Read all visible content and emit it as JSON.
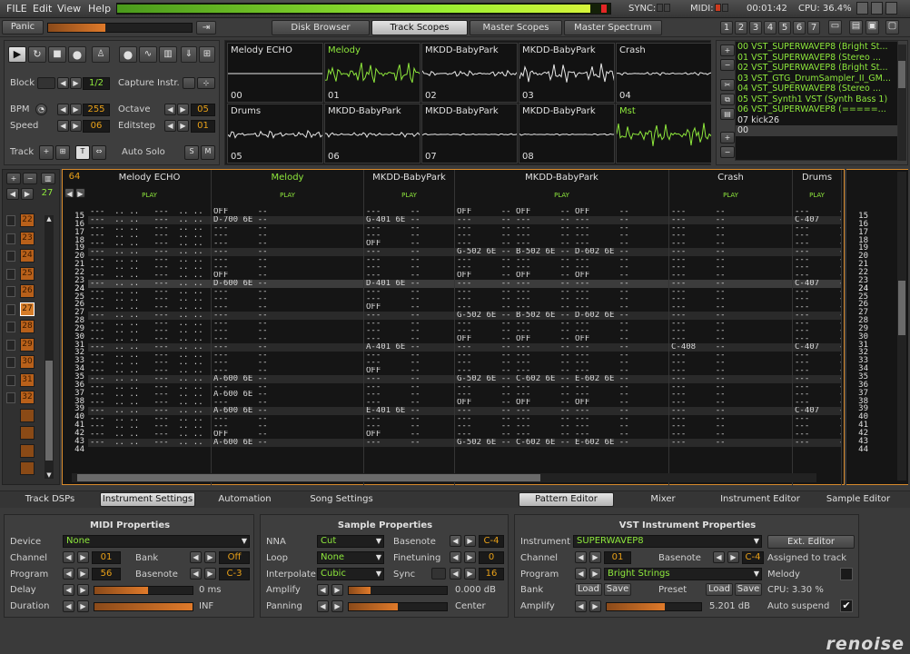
{
  "menu": {
    "file": "FILE",
    "edit": "Edit",
    "view": "View",
    "help": "Help"
  },
  "status": {
    "sync": "SYNC:",
    "midi": "MIDI:",
    "time": "00:01:42",
    "cpu": "CPU: 36.4%"
  },
  "toolbar": {
    "panic": "Panic",
    "tabs": [
      "Disk Browser",
      "Track Scopes",
      "Master Scopes",
      "Master Spectrum"
    ],
    "active_tab": "Track Scopes",
    "pages": [
      "1",
      "2",
      "3",
      "4",
      "5",
      "6",
      "7"
    ]
  },
  "transport": {
    "block_label": "Block",
    "block_value": "1/2",
    "capture_label": "Capture Instr.",
    "bpm_label": "BPM",
    "bpm_value": "255",
    "octave_label": "Octave",
    "octave_value": "05",
    "speed_label": "Speed",
    "speed_value": "06",
    "editstep_label": "Editstep",
    "editstep_value": "01",
    "track_label": "Track",
    "autosolo_label": "Auto Solo"
  },
  "scopes": [
    {
      "name": "Melody ECHO",
      "num": "00"
    },
    {
      "name": "Melody",
      "num": "01"
    },
    {
      "name": "MKDD-BabyPark",
      "num": "02"
    },
    {
      "name": "MKDD-BabyPark",
      "num": "03"
    },
    {
      "name": "Crash",
      "num": "04"
    },
    {
      "name": "Drums",
      "num": "05"
    },
    {
      "name": "MKDD-BabyPark",
      "num": "06"
    },
    {
      "name": "MKDD-BabyPark",
      "num": "07"
    },
    {
      "name": "MKDD-BabyPark",
      "num": "08"
    },
    {
      "name": "Mst",
      "num": ""
    }
  ],
  "instruments": [
    "00 VST_SUPERWAVEP8 (Bright St...",
    "01 VST_SUPERWAVEP8 (Stereo ...",
    "02 VST_SUPERWAVEP8 (Bright St...",
    "03 VST_GTG_DrumSampler_II_GM...",
    "04 VST_SUPERWAVEP8 (Stereo ...",
    "05 VST_Synth1 VST (Synth Bass 1)",
    "06 VST_SUPERWAVEP8 (=====...",
    "07 kick26",
    "00"
  ],
  "pattern": {
    "lines": "64",
    "seq_pos": "27",
    "tracks": [
      "Melody ECHO",
      "Melody",
      "MKDD-BabyPark",
      "MKDD-BabyPark",
      "Crash",
      "Drums"
    ],
    "play": "PLAY",
    "row_numbers": [
      "15",
      "16",
      "17",
      "18",
      "19",
      "20",
      "21",
      "22",
      "23",
      "24",
      "25",
      "26",
      "27",
      "28",
      "29",
      "30",
      "31",
      "32",
      "33",
      "34",
      "35",
      "36",
      "37",
      "38",
      "39",
      "40",
      "41",
      "42",
      "43",
      "44"
    ],
    "sequence": [
      "22",
      "23",
      "24",
      "25",
      "26",
      "27",
      "28",
      "29",
      "30",
      "31",
      "32"
    ],
    "melody": [
      "OFF",
      "D-700 6E",
      "---",
      "---",
      "---",
      "---",
      "---",
      "---",
      "OFF",
      "D-600 6E",
      "---",
      "---",
      "---",
      "---",
      "---",
      "---",
      "---",
      "---",
      "---",
      "---",
      "---",
      "A-600 6E",
      "---",
      "A-600 6E",
      "---",
      "A-600 6E",
      "---",
      "---",
      "OFF",
      "A-600 6E"
    ],
    "mkdd1": [
      "---",
      "G-401 6E",
      "---",
      "---",
      "OFF",
      "---",
      "---",
      "---",
      "---",
      "D-401 6E",
      "---",
      "---",
      "OFF",
      "---",
      "---",
      "---",
      "---",
      "A-401 6E",
      "---",
      "---",
      "OFF",
      "---",
      "---",
      "---",
      "---",
      "E-401 6E",
      "---",
      "---",
      "OFF",
      "---"
    ],
    "mkdd2a": [
      "OFF",
      "---",
      "---",
      "---",
      "---",
      "G-502 6E",
      "---",
      "---",
      "OFF",
      "---",
      "---",
      "---",
      "---",
      "G-502 6E",
      "---",
      "---",
      "OFF",
      "---",
      "---",
      "---",
      "---",
      "G-502 6E",
      "---",
      "---",
      "OFF",
      "---",
      "---",
      "---",
      "---",
      "G-502 6E"
    ],
    "mkdd2b": [
      "OFF",
      "---",
      "---",
      "---",
      "---",
      "B-502 6E",
      "---",
      "---",
      "OFF",
      "---",
      "---",
      "---",
      "---",
      "B-502 6E",
      "---",
      "---",
      "OFF",
      "---",
      "---",
      "---",
      "---",
      "C-602 6E",
      "---",
      "---",
      "OFF",
      "---",
      "---",
      "---",
      "---",
      "C-602 6E"
    ],
    "mkdd2c": [
      "OFF",
      "---",
      "---",
      "---",
      "---",
      "D-602 6E",
      "---",
      "---",
      "OFF",
      "---",
      "---",
      "---",
      "---",
      "D-602 6E",
      "---",
      "---",
      "OFF",
      "---",
      "---",
      "---",
      "---",
      "E-602 6E",
      "---",
      "---",
      "OFF",
      "---",
      "---",
      "---",
      "---",
      "E-602 6E"
    ],
    "crash": [
      "---",
      "---",
      "---",
      "---",
      "---",
      "---",
      "---",
      "---",
      "---",
      "---",
      "---",
      "---",
      "---",
      "---",
      "---",
      "---",
      "---",
      "C-408",
      "---",
      "---",
      "---",
      "---",
      "---",
      "---",
      "---",
      "---",
      "---",
      "---",
      "---",
      "---"
    ],
    "drums": [
      "---",
      "C-407",
      "---",
      "---",
      "---",
      "---",
      "---",
      "---",
      "---",
      "C-407",
      "---",
      "---",
      "---",
      "---",
      "---",
      "---",
      "---",
      "C-407",
      "---",
      "---",
      "---",
      "---",
      "---",
      "---",
      "---",
      "C-407",
      "---",
      "---",
      "---",
      "---"
    ]
  },
  "bottom_tabs": {
    "left": [
      "Track DSPs",
      "Instrument Settings",
      "Automation",
      "Song Settings"
    ],
    "right": [
      "Pattern Editor",
      "Mixer",
      "Instrument Editor",
      "Sample Editor"
    ]
  },
  "midi": {
    "title": "MIDI Properties",
    "device_label": "Device",
    "device": "None",
    "channel_label": "Channel",
    "channel": "01",
    "bank_label": "Bank",
    "bank": "Off",
    "program_label": "Program",
    "program": "56",
    "basenote_label": "Basenote",
    "basenote": "C-3",
    "delay_label": "Delay",
    "delay": "0 ms",
    "duration_label": "Duration",
    "duration": "INF",
    "delay_level": 0.55,
    "duration_level": 1.0
  },
  "sample": {
    "title": "Sample Properties",
    "nna_label": "NNA",
    "nna": "Cut",
    "basenote_label": "Basenote",
    "basenote": "C-4",
    "loop_label": "Loop",
    "loop": "None",
    "finetuning_label": "Finetuning",
    "finetuning": "0",
    "interp_label": "Interpolate",
    "interp": "Cubic",
    "sync_label": "Sync",
    "sync": "16",
    "amplify_label": "Amplify",
    "amplify": "0.000 dB",
    "panning_label": "Panning",
    "panning": "Center",
    "amplify_level": 0.22,
    "panning_level": 0.5
  },
  "vst": {
    "title": "VST Instrument Properties",
    "instrument_label": "Instrument",
    "instrument": "SUPERWAVEP8",
    "ext_editor": "Ext. Editor",
    "channel_label": "Channel",
    "channel": "01",
    "basenote_label": "Basenote",
    "basenote": "C-4",
    "assigned_label": "Assigned to track",
    "program_label": "Program",
    "program": "Bright Strings",
    "track": "Melody",
    "bank_label": "Bank",
    "load": "Load",
    "save": "Save",
    "preset_label": "Preset",
    "cpu": "CPU: 3.30 %",
    "amplify_label": "Amplify",
    "amplify": "5.201 dB",
    "autosuspend_label": "Auto suspend",
    "amplify_level": 0.62
  },
  "logo": "renoise"
}
